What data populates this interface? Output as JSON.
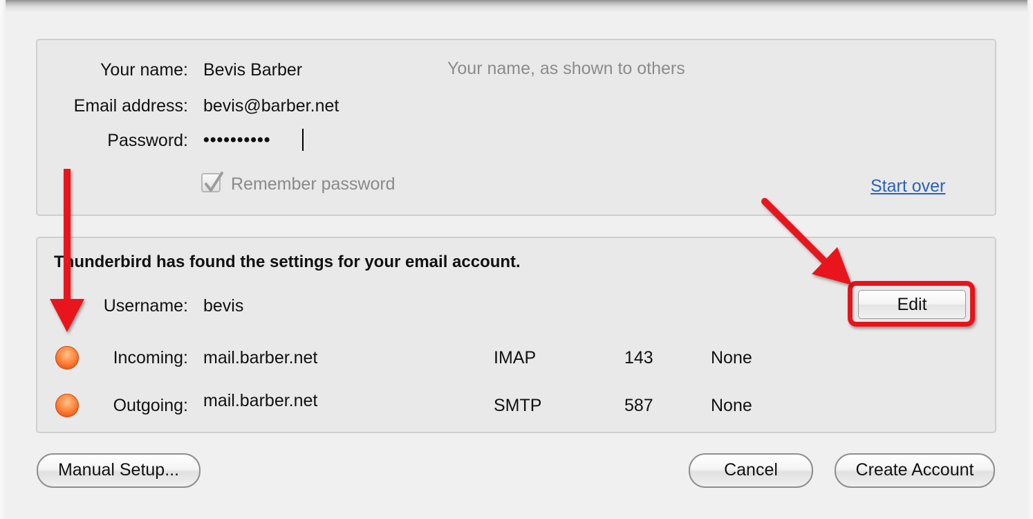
{
  "form": {
    "name_label": "Your name:",
    "name_value": "Bevis Barber",
    "name_hint": "Your name, as shown to others",
    "email_label": "Email address:",
    "email_value": "bevis@barber.net",
    "password_label": "Password:",
    "password_value": "••••••••••",
    "remember_label": "Remember password",
    "remember_checked": true,
    "start_over": "Start over"
  },
  "found": {
    "message": "Thunderbird has found the settings for your email account.",
    "username_label": "Username:",
    "username_value": "bevis",
    "edit_label": "Edit",
    "incoming": {
      "label": "Incoming:",
      "server": "mail.barber.net",
      "protocol": "IMAP",
      "port": "143",
      "security": "None"
    },
    "outgoing": {
      "label": "Outgoing:",
      "server": "mail.barber.net",
      "protocol": "SMTP",
      "port": "587",
      "security": "None"
    }
  },
  "buttons": {
    "manual_setup": "Manual Setup...",
    "cancel": "Cancel",
    "create_account": "Create Account"
  },
  "colors": {
    "annotation_red": "#e8131b",
    "status_orange": "#f26a22",
    "link_blue": "#2a62b8"
  },
  "icons": {
    "status": "status-dot-icon",
    "check": "checkmark-icon"
  }
}
